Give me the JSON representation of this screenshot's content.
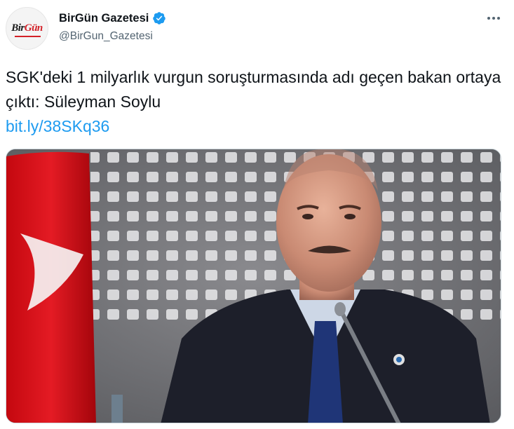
{
  "account": {
    "display_name": "BirGün Gazetesi",
    "handle": "@BirGun_Gazetesi",
    "avatar_logo_main": "Bir",
    "avatar_logo_accent": "Gün",
    "verified": true
  },
  "tweet": {
    "text": "SGK'deki 1 milyarlık vurgun soruşturmasında adı geçen bakan ortaya çıktı: Süleyman Soylu",
    "link": "bit.ly/38SKq36"
  },
  "colors": {
    "link": "#1d9bf0",
    "verified": "#1d9bf0",
    "secondary_text": "#536471",
    "flag_red": "#e30a17"
  },
  "icons": {
    "verified": "verified-badge-icon",
    "more": "more-dots-icon"
  }
}
